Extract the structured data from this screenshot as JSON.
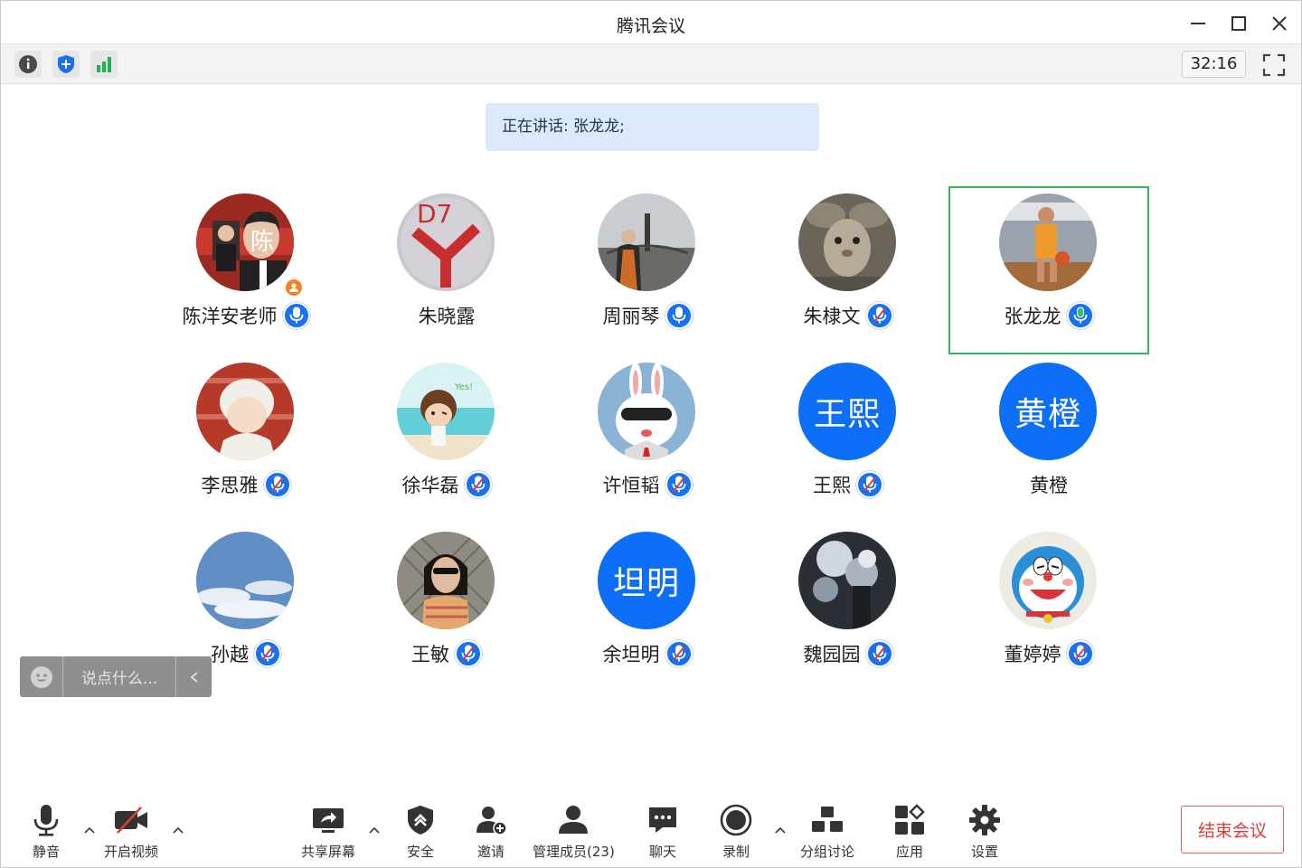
{
  "window": {
    "title": "腾讯会议"
  },
  "infobar": {
    "timer": "32:16"
  },
  "speaking": {
    "text": "正在讲话: 张龙龙;"
  },
  "participants": [
    {
      "name": "陈洋安老师",
      "avatar": "photo",
      "avatar_icon": "teacher-photo",
      "mic": "on",
      "host": true
    },
    {
      "name": "朱晓露",
      "avatar": "photo",
      "avatar_icon": "logo-photo",
      "mic": "none"
    },
    {
      "name": "周丽琴",
      "avatar": "photo",
      "avatar_icon": "landscape-photo",
      "mic": "on"
    },
    {
      "name": "朱棣文",
      "avatar": "photo",
      "avatar_icon": "rabbit-photo",
      "mic": "muted"
    },
    {
      "name": "张龙龙",
      "avatar": "photo",
      "avatar_icon": "athlete-photo",
      "mic": "speaking",
      "active": true
    },
    {
      "name": "李思雅",
      "avatar": "photo",
      "avatar_icon": "cartoon-girl-photo",
      "mic": "muted"
    },
    {
      "name": "徐华磊",
      "avatar": "photo",
      "avatar_icon": "beach-cartoon-photo",
      "mic": "muted"
    },
    {
      "name": "许恒韬",
      "avatar": "photo",
      "avatar_icon": "bunny-cartoon-photo",
      "mic": "muted"
    },
    {
      "name": "王熙",
      "avatar": "text",
      "avatar_text": "王熙",
      "mic": "muted"
    },
    {
      "name": "黄橙",
      "avatar": "text",
      "avatar_text": "黄橙",
      "mic": "none"
    },
    {
      "name": "孙越",
      "avatar": "photo",
      "avatar_icon": "sky-photo",
      "mic": "muted"
    },
    {
      "name": "王敏",
      "avatar": "photo",
      "avatar_icon": "portrait-photo",
      "mic": "muted"
    },
    {
      "name": "余坦明",
      "avatar": "text",
      "avatar_text": "坦明",
      "mic": "muted"
    },
    {
      "name": "魏园园",
      "avatar": "photo",
      "avatar_icon": "tree-photo",
      "mic": "muted"
    },
    {
      "name": "董婷婷",
      "avatar": "photo",
      "avatar_icon": "doraemon-photo",
      "mic": "muted"
    }
  ],
  "chat": {
    "placeholder": "说点什么..."
  },
  "toolbar": {
    "mute": "静音",
    "video": "开启视频",
    "share": "共享屏幕",
    "security": "安全",
    "invite": "邀请",
    "members": "管理成员(23)",
    "chat": "聊天",
    "record": "录制",
    "breakout": "分组讨论",
    "apps": "应用",
    "settings": "设置",
    "end": "结束会议"
  },
  "colors": {
    "accent": "#1870f2",
    "speaking_border": "#35b55c",
    "end_red": "#e03b3b",
    "host_badge": "#f6811f"
  }
}
